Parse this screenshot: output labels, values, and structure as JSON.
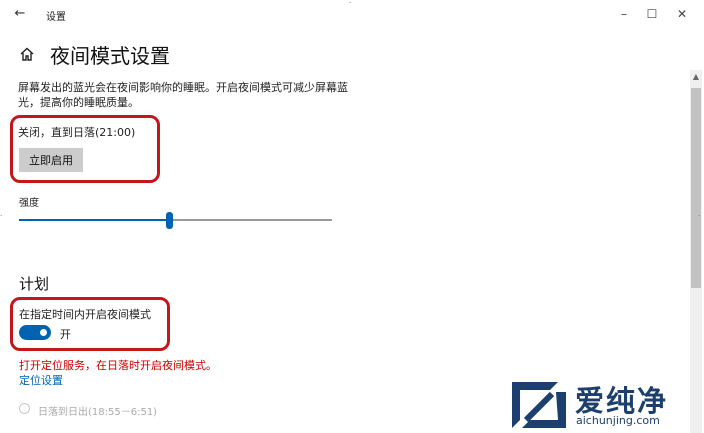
{
  "window": {
    "title": "设置",
    "back_icon": "back-arrow-icon",
    "minimize_glyph": "–",
    "maximize_glyph": "☐",
    "close_glyph": "✕"
  },
  "page": {
    "home_icon": "home-icon",
    "title": "夜间模式设置",
    "description": "屏幕发出的蓝光会在夜间影响你的睡眠。开启夜间模式可减少屏幕蓝光，提高你的睡眠质量。",
    "status": "关闭，直到日落(21:00)",
    "enable_button": "立即启用",
    "strength_label": "强度",
    "strength_level": 0.48
  },
  "schedule": {
    "title": "计划",
    "toggle_label": "在指定时间内开启夜间模式",
    "toggle_state": "开",
    "warning": "打开定位服务，在日落时开启夜间模式。",
    "location_link": "定位设置",
    "sunset_option": "日落到日出(18:55－6:51)"
  },
  "watermark": {
    "text": "爱纯净",
    "url": "aichunjing.com",
    "icon": "brand-logo-icon"
  },
  "colors": {
    "accent": "#0063b1",
    "annotation_red": "#c3171c",
    "warning_red": "#c80000",
    "button_gray": "#cccccc",
    "brand_navy": "#1c3f70"
  }
}
